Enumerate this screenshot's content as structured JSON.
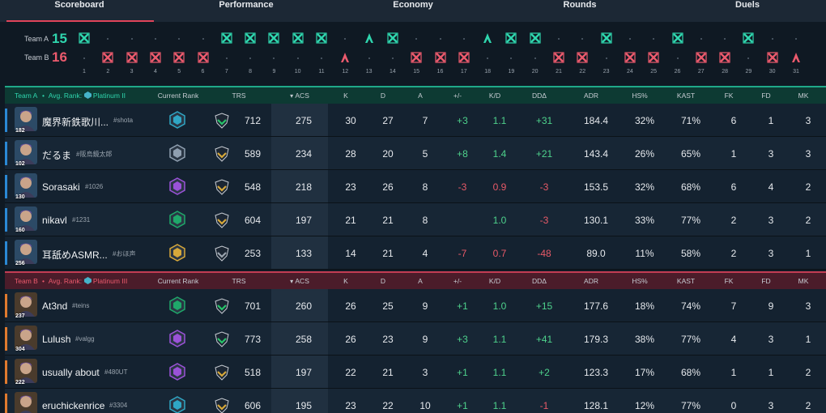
{
  "tabs": [
    {
      "label": "Scoreboard",
      "active": true
    },
    {
      "label": "Performance",
      "active": false
    },
    {
      "label": "Economy",
      "active": false
    },
    {
      "label": "Rounds",
      "active": false
    },
    {
      "label": "Duels",
      "active": false
    }
  ],
  "rounds": {
    "team_a": {
      "label": "Team A",
      "score": "15"
    },
    "team_b": {
      "label": "Team B",
      "score": "16"
    },
    "numbers": [
      "1",
      "2",
      "3",
      "4",
      "5",
      "6",
      "7",
      "8",
      "9",
      "10",
      "11",
      "12",
      "13",
      "14",
      "15",
      "16",
      "17",
      "18",
      "19",
      "20",
      "21",
      "22",
      "23",
      "24",
      "25",
      "26",
      "27",
      "28",
      "29",
      "30",
      "31"
    ],
    "winners": [
      "A",
      "B",
      "B",
      "B",
      "B",
      "B",
      "A",
      "A",
      "A",
      "A",
      "A",
      "B",
      "A",
      "A",
      "B",
      "B",
      "B",
      "A",
      "A",
      "A",
      "B",
      "B",
      "A",
      "B",
      "B",
      "A",
      "B",
      "B",
      "A",
      "B",
      "B"
    ],
    "win_type": [
      "elim",
      "elim",
      "elim",
      "elim",
      "elim",
      "elim",
      "elim",
      "elim",
      "elim",
      "elim",
      "elim",
      "spike",
      "spike",
      "elim",
      "elim",
      "elim",
      "elim",
      "spike",
      "elim",
      "elim",
      "elim",
      "elim",
      "elim",
      "elim",
      "elim",
      "elim",
      "elim",
      "elim",
      "elim",
      "elim",
      "spike"
    ]
  },
  "columns": {
    "current_rank": "Current Rank",
    "trs": "TRS",
    "acs": "ACS",
    "k": "K",
    "d": "D",
    "a": "A",
    "pm": "+/-",
    "kd": "K/D",
    "dd": "DDΔ",
    "adr": "ADR",
    "hs": "HS%",
    "kast": "KAST",
    "fk": "FK",
    "fd": "FD",
    "mk": "MK"
  },
  "team_a": {
    "name": "Team A",
    "avg_rank_label": "Avg. Rank:",
    "avg_rank": "Platinum II",
    "players": [
      {
        "name": "魔界新鉄歌川...",
        "tag": "#shota",
        "level": "182",
        "rank_color": "#2fa6c4",
        "trs_color": "#27c46a",
        "trs": "712",
        "acs": "275",
        "k": "30",
        "d": "27",
        "a": "7",
        "pm": "+3",
        "kd": "1.1",
        "dd": "+31",
        "adr": "184.4",
        "hs": "32%",
        "kast": "71%",
        "fk": "6",
        "fd": "1",
        "mk": "3"
      },
      {
        "name": "だるま",
        "tag": "#阪烏鏡太郎",
        "level": "102",
        "rank_color": "#8f9fb0",
        "trs_color": "#d6a83a",
        "trs": "589",
        "acs": "234",
        "k": "28",
        "d": "20",
        "a": "5",
        "pm": "+8",
        "kd": "1.4",
        "dd": "+21",
        "adr": "143.4",
        "hs": "26%",
        "kast": "65%",
        "fk": "1",
        "fd": "3",
        "mk": "3"
      },
      {
        "name": "Sorasaki",
        "tag": "#1026",
        "level": "130",
        "rank_color": "#9a52d8",
        "trs_color": "#d6a83a",
        "trs": "548",
        "acs": "218",
        "k": "23",
        "d": "26",
        "a": "8",
        "pm": "-3",
        "kd": "0.9",
        "dd": "-3",
        "adr": "153.5",
        "hs": "32%",
        "kast": "68%",
        "fk": "6",
        "fd": "4",
        "mk": "2"
      },
      {
        "name": "nikavl",
        "tag": "#1231",
        "level": "160",
        "rank_color": "#1fa86a",
        "trs_color": "#d6a83a",
        "trs": "604",
        "acs": "197",
        "k": "21",
        "d": "21",
        "a": "8",
        "pm": "",
        "kd": "1.0",
        "dd": "-3",
        "adr": "130.1",
        "hs": "33%",
        "kast": "77%",
        "fk": "2",
        "fd": "3",
        "mk": "2"
      },
      {
        "name": "耳舐めASMR...",
        "tag": "#おほ声",
        "level": "256",
        "rank_color": "#d6a83a",
        "trs_color": "#9aa4ae",
        "trs": "253",
        "acs": "133",
        "k": "14",
        "d": "21",
        "a": "4",
        "pm": "-7",
        "kd": "0.7",
        "dd": "-48",
        "adr": "89.0",
        "hs": "11%",
        "kast": "58%",
        "fk": "2",
        "fd": "3",
        "mk": "1"
      }
    ]
  },
  "team_b": {
    "name": "Team B",
    "avg_rank_label": "Avg. Rank:",
    "avg_rank": "Platinum III",
    "players": [
      {
        "name": "At3nd",
        "tag": "#teins",
        "level": "237",
        "rank_color": "#1fa86a",
        "trs_color": "#27c46a",
        "trs": "701",
        "acs": "260",
        "k": "26",
        "d": "25",
        "a": "9",
        "pm": "+1",
        "kd": "1.0",
        "dd": "+15",
        "adr": "177.6",
        "hs": "18%",
        "kast": "74%",
        "fk": "7",
        "fd": "9",
        "mk": "3"
      },
      {
        "name": "Lulush",
        "tag": "#valgg",
        "level": "304",
        "rank_color": "#9a52d8",
        "trs_color": "#27c46a",
        "trs": "773",
        "acs": "258",
        "k": "26",
        "d": "23",
        "a": "9",
        "pm": "+3",
        "kd": "1.1",
        "dd": "+41",
        "adr": "179.3",
        "hs": "38%",
        "kast": "77%",
        "fk": "4",
        "fd": "3",
        "mk": "1"
      },
      {
        "name": "usually about",
        "tag": "#480UT",
        "level": "222",
        "rank_color": "#9a52d8",
        "trs_color": "#d6a83a",
        "trs": "518",
        "acs": "197",
        "k": "22",
        "d": "21",
        "a": "3",
        "pm": "+1",
        "kd": "1.1",
        "dd": "+2",
        "adr": "123.3",
        "hs": "17%",
        "kast": "68%",
        "fk": "1",
        "fd": "1",
        "mk": "2"
      },
      {
        "name": "eruchickenrice",
        "tag": "#3304",
        "level": "",
        "rank_color": "#2fa6c4",
        "trs_color": "#d6a83a",
        "trs": "606",
        "acs": "195",
        "k": "23",
        "d": "22",
        "a": "10",
        "pm": "+1",
        "kd": "1.1",
        "dd": "-1",
        "adr": "128.1",
        "hs": "12%",
        "kast": "77%",
        "fk": "0",
        "fd": "3",
        "mk": "2"
      }
    ]
  },
  "colors": {
    "team_a": "#2fd6ae",
    "team_b": "#ec5a6d",
    "positive": "#4ed28c",
    "negative": "#e85a68"
  }
}
